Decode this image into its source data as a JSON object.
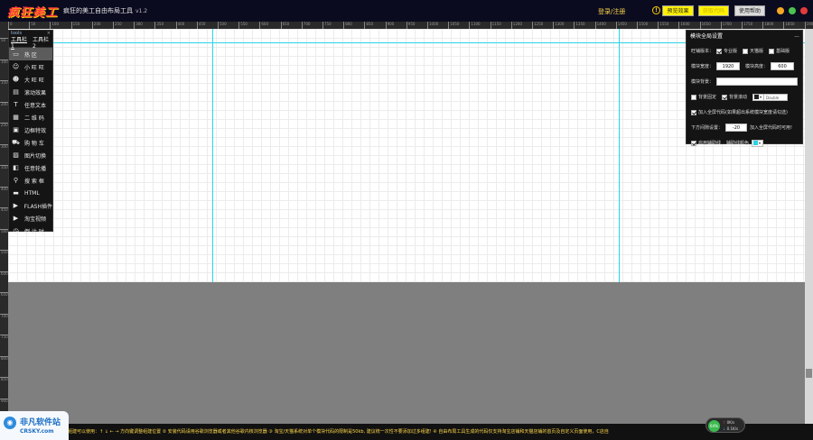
{
  "app": {
    "logo_text": "疯狂美工",
    "title": "疯狂的美工自由布局工具",
    "version": "v1.2",
    "login": "登录/注册",
    "help_symbol": "!",
    "buttons": {
      "preview": "预览效果",
      "get_code": "获取代码",
      "help": "使用帮助"
    }
  },
  "ruler": {
    "h_labels": [
      "0",
      "50",
      "100",
      "150",
      "200",
      "250",
      "300",
      "350",
      "400",
      "450",
      "500",
      "550",
      "600",
      "650",
      "700",
      "750",
      "800",
      "850",
      "900",
      "950",
      "1000",
      "1050",
      "1100",
      "1150",
      "1200",
      "1250",
      "1300",
      "1350",
      "1400",
      "1450",
      "1500",
      "1550",
      "1600",
      "1650",
      "1700",
      "1750",
      "1800",
      "1850",
      "1900"
    ],
    "v_labels": [
      "50",
      "100",
      "150",
      "200",
      "250",
      "300",
      "350",
      "400",
      "450",
      "500",
      "550",
      "600",
      "650",
      "700",
      "750",
      "800",
      "850",
      "900"
    ]
  },
  "tools": {
    "header": "tools",
    "close": "×",
    "tabs": [
      "工具栏1",
      "工具栏2"
    ],
    "items": [
      {
        "label": "热  区",
        "icon": "▭"
      },
      {
        "label": "小 旺 旺",
        "icon": "☺"
      },
      {
        "label": "大 旺 旺",
        "icon": "☻"
      },
      {
        "label": "滚动效果",
        "icon": "▤"
      },
      {
        "label": "任意文本",
        "icon": "T"
      },
      {
        "label": "二 维 码",
        "icon": "▦"
      },
      {
        "label": "边框特效",
        "icon": "▣"
      },
      {
        "label": "购 物 车",
        "icon": "⛟"
      },
      {
        "label": "图片切换",
        "icon": "▨"
      },
      {
        "label": "任意轮播",
        "icon": "◧"
      },
      {
        "label": "搜 索 框",
        "icon": "⚲"
      },
      {
        "label": "HTML",
        "icon": "▬"
      },
      {
        "label": "FLASH插件",
        "icon": "▶"
      },
      {
        "label": "淘宝视频",
        "icon": "▶"
      },
      {
        "label": "倒 计 时",
        "icon": "◷"
      }
    ]
  },
  "settings": {
    "title": "模块全局设置",
    "close": "—",
    "shop_version_label": "旺铺版本：",
    "shop_versions": [
      "专业版",
      "天猫版",
      "基础版"
    ],
    "width_label": "模块宽度：",
    "width_value": "1920",
    "height_label": "模块高度：",
    "height_value": "600",
    "bg_label": "模块背景：",
    "bg_value": "",
    "bg_fixed": "背景固定",
    "bg_scroll": "背景滚动",
    "bg_color_text": "Double",
    "fullscreen_label": "加入全屏代码(如果超出系统模块宽度请勾选)",
    "offset_label": "下方间隙设置：",
    "offset_value": "-20",
    "offset_suffix": "加入全屏代码时可用!",
    "guides_label": "启用辅助线",
    "guides_color_label": "辅助线颜色",
    "colors": {
      "bg_swatch": "#222222",
      "guide_swatch": "#29d4e6"
    }
  },
  "status": {
    "ticker": "热区的组建可以使用：↑ ↓ ← → 方向键调整组建位置   ② 安装代码请用谷歌浏览器或者其他谷歌内核浏览器   ③ 淘宝/天猫系统对单个模块代码的限制是50kb, 建议统一次性不要添加过多组建!   ④ 自由布局工具生成的代码仅支持淘宝店铺和天猫店铺的首页及自定义页面使用，C店自",
    "net_percent": "64%",
    "net_up": "0K/s",
    "net_down": "0.1K/s"
  },
  "watermark": {
    "name": "非凡软件站",
    "url": "CRSKY.com"
  }
}
